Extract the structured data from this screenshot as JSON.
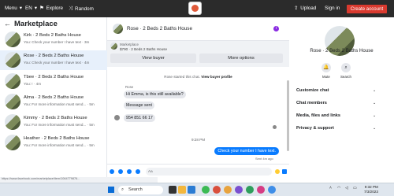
{
  "topbar": {
    "menu_label": "Menu",
    "lang_label": "EN",
    "explore_label": "Explore",
    "random_label": "Random",
    "upload_label": "Upload",
    "signin_label": "Sign in",
    "create_label": "Create account"
  },
  "left_panel": {
    "title": "Marketplace",
    "items": [
      {
        "name": "Kirk · 2 Beds 2 Baths House",
        "sub": "You: Check your number I have text · 3m"
      },
      {
        "name": "Rose · 2 Beds 2 Baths House",
        "sub": "You: Check your number I have text · 4m"
      },
      {
        "name": "Tbee · 2 Beds 2 Baths House",
        "sub": "You: ! · 4m"
      },
      {
        "name": "Alma · 2 Beds 2 Baths House",
        "sub": "You: For more information must send... · 5m"
      },
      {
        "name": "Kimmy · 2 Beds 2 Baths House",
        "sub": "You: For more information must send... · 5m"
      },
      {
        "name": "Heather · 2 Beds 2 Baths House",
        "sub": "You: For more information must send... · 5m"
      }
    ]
  },
  "chat": {
    "title": "Rose · 2 Beds 2 Baths House",
    "marketplace_label": "Marketplace",
    "price": "$790 · 2 Beds 2 Baths House",
    "view_buyer": "View buyer",
    "more_options": "More options",
    "started_text": "Rose started this chat.",
    "view_profile": "View buyer profile",
    "sender": "Rose",
    "msg1": "Hi Emma, is this still available?",
    "msg2": "Message sent",
    "msg3": "954 851 66 17",
    "time": "9:28 PM",
    "msg_out": "Check your number I have text.",
    "sent_status": "Sent 4m ago",
    "composer_placeholder": "Aa"
  },
  "right_panel": {
    "name": "Rose · 2 Beds 2 Baths House",
    "mute": "Mute",
    "search": "Search",
    "sections": [
      "Customize chat",
      "Chat members",
      "Media, files and links",
      "Privacy & support"
    ]
  },
  "status_url": "https://www.facebook.com/marketplace/item/1064779876...",
  "taskbar": {
    "search": "Search",
    "clock_time": "9:32 PM",
    "clock_date": "7/3/2023"
  }
}
